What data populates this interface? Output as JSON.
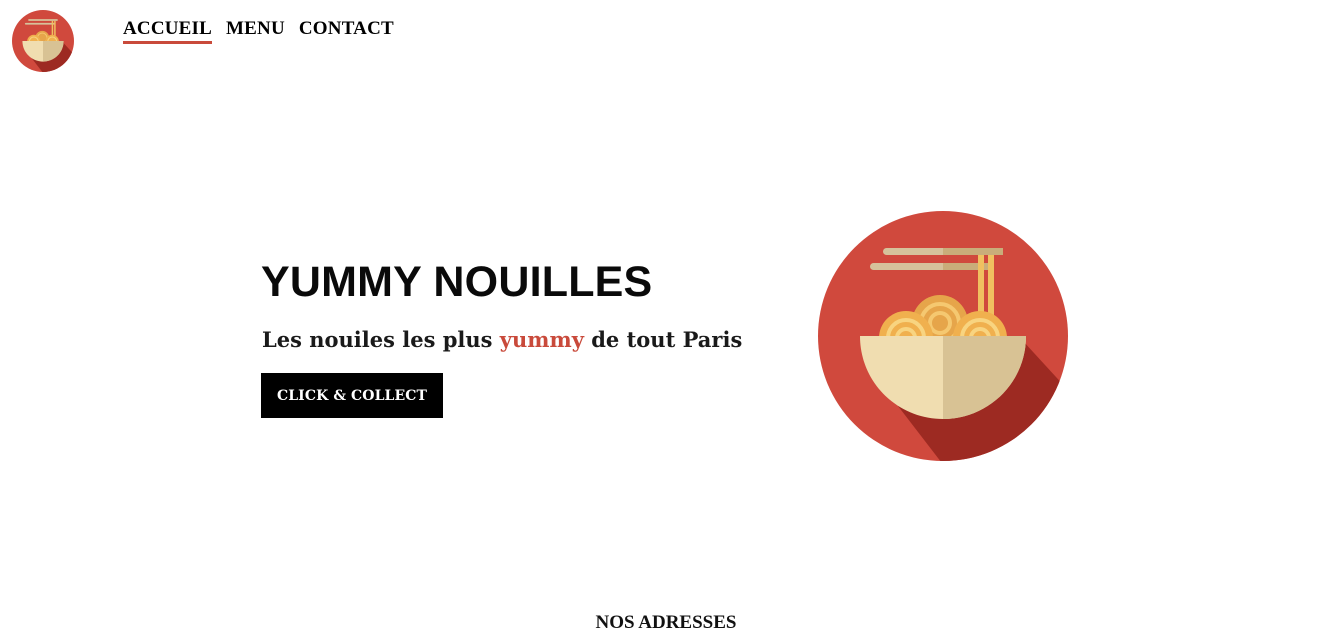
{
  "brand": {
    "logo_icon": "noodle-bowl-icon",
    "accent_color": "#c94a3b"
  },
  "nav": {
    "items": [
      {
        "label": "ACCUEIL",
        "active": true
      },
      {
        "label": "MENU",
        "active": false
      },
      {
        "label": "CONTACT",
        "active": false
      }
    ]
  },
  "hero": {
    "title": "YUMMY NOUILLES",
    "subtitle_before": "Les nouiles les plus",
    "subtitle_accent": "yummy",
    "subtitle_after": "de tout Paris",
    "cta_label": "CLICK & COLLECT",
    "image_icon": "noodle-bowl-illustration"
  },
  "sections": {
    "addresses_title": "NOS ADRESSES"
  }
}
